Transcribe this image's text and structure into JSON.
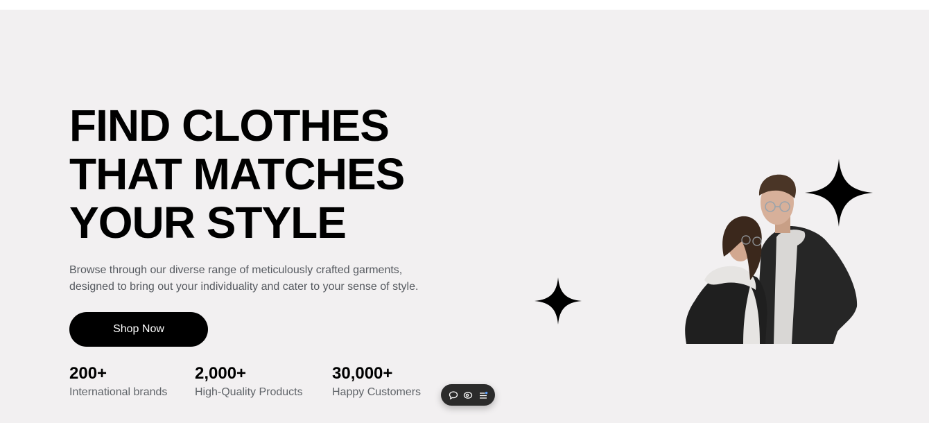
{
  "hero": {
    "headline_line1": "FIND CLOTHES",
    "headline_line2": "THAT MATCHES",
    "headline_line3": "YOUR STYLE",
    "subtitle_line1": "Browse through our diverse range of meticulously crafted garments,",
    "subtitle_line2": "designed to bring out your individuality and cater to your sense of style.",
    "cta_label": "Shop Now"
  },
  "stats": [
    {
      "value": "200+",
      "label": "International brands"
    },
    {
      "value": "2,000+",
      "label": "High-Quality Products"
    },
    {
      "value": "30,000+",
      "label": "Happy Customers"
    }
  ],
  "toolbar": {
    "icons": [
      "comment-icon",
      "eye-icon",
      "menu-icon"
    ]
  },
  "colors": {
    "hero_background": "#f2f0f1",
    "primary": "#000000",
    "text_muted": "#5f6368",
    "toolbar_background": "#2b2b2b"
  }
}
